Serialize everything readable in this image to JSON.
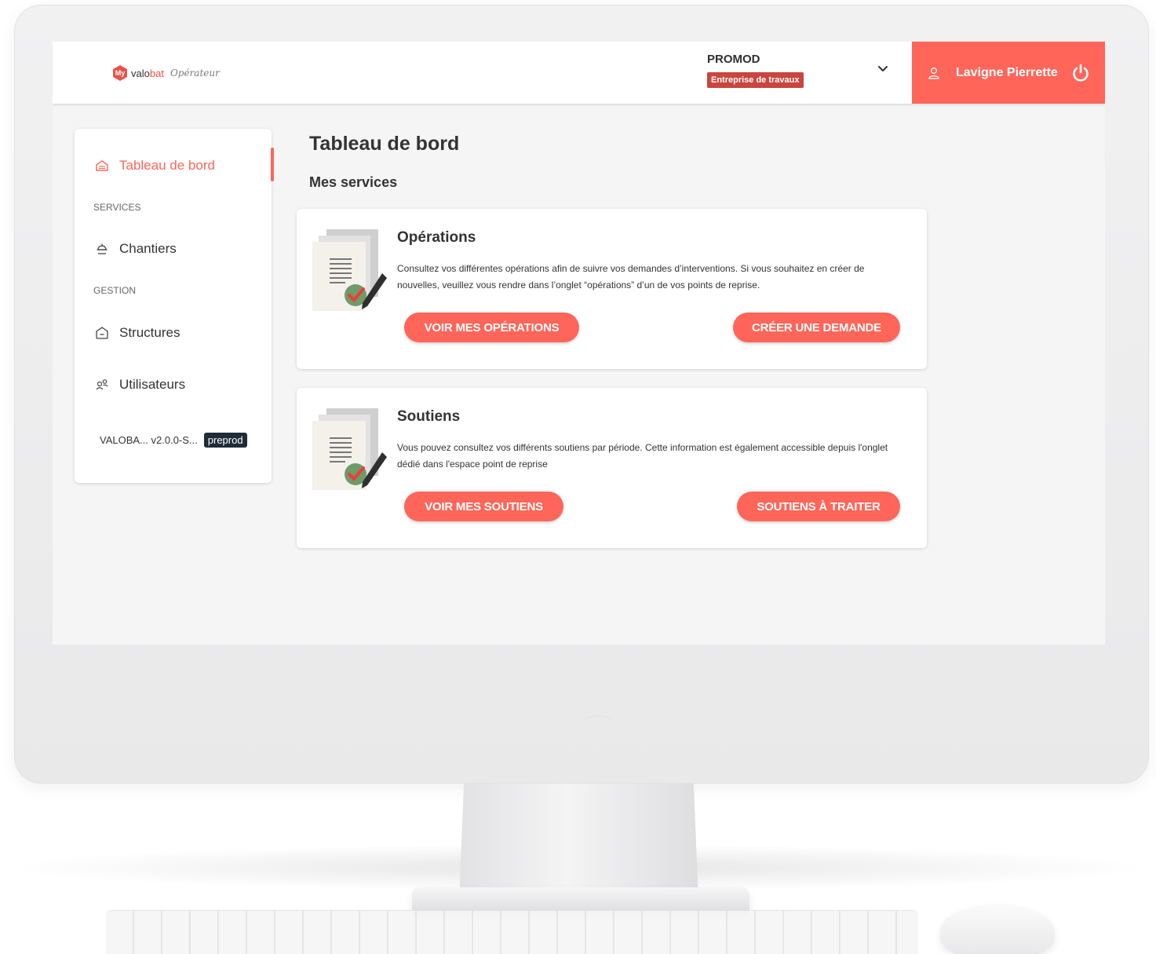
{
  "brand": {
    "mark": "My",
    "name_part1": "valo",
    "name_part2": "bat",
    "subtitle": "Opérateur",
    "accent_color": "#ff6559"
  },
  "header": {
    "company_name": "PROMOD",
    "company_type": "Entreprise de travaux",
    "dropdown_icon": "chevron-down-icon",
    "user_icon": "user-icon",
    "user_name": "Lavigne Pierrette",
    "logout_icon": "power-icon"
  },
  "sidebar": {
    "items": [
      {
        "label": "Tableau de bord",
        "icon": "dashboard-icon",
        "active": true
      },
      {
        "label": "Chantiers",
        "icon": "building-site-icon"
      },
      {
        "label": "Structures",
        "icon": "structure-icon"
      },
      {
        "label": "Utilisateurs",
        "icon": "users-icon"
      }
    ],
    "sections": [
      "SERVICES",
      "GESTION"
    ],
    "version": "VALOBA... v2.0.0-S...",
    "environment": "preprod"
  },
  "main": {
    "title": "Tableau de bord",
    "section_title": "Mes services",
    "cards": [
      {
        "title": "Opérations",
        "description": "Consultez vos différentes opérations afin de suivre vos demandes d’interventions. Si vous souhaitez en créer de nouvelles, veuillez vous rendre dans l’onglet “opérations” d’un de vos points de reprise.",
        "primary_button": "VOIR MES OPÉRATIONS",
        "secondary_button": "CRÉER UNE DEMANDE"
      },
      {
        "title": "Soutiens",
        "description": "Vous pouvez consultez vos différents soutiens par période. Cette information est également accessible depuis l'onglet dédié dans l'espace point de reprise",
        "primary_button": "VOIR MES SOUTIENS",
        "secondary_button": "SOUTIENS À TRAITER"
      }
    ]
  }
}
